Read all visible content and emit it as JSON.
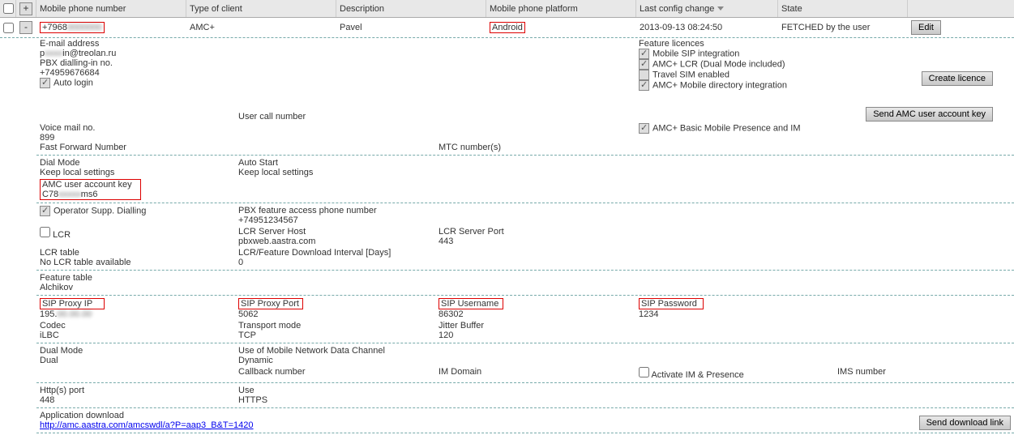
{
  "headers": {
    "phone": "Mobile phone number",
    "client": "Type of client",
    "desc": "Description",
    "platform": "Mobile phone platform",
    "lastcfg": "Last config change",
    "state": "State"
  },
  "row": {
    "phone_pre": "+7968",
    "phone_blur": "0000000",
    "client": "AMC+",
    "desc": "Pavel",
    "platform": "Android",
    "lastcfg": "2013-09-13 08:24:50",
    "state": "FETCHED by the user",
    "edit": "Edit"
  },
  "d": {
    "email_lbl": "E-mail address",
    "email_pre": "p",
    "email_suf": "in@treolan.ru",
    "pbx_lbl": "PBX dialling-in no.",
    "pbx": "+74959676684",
    "autologin": "Auto login",
    "usercall": "User call number",
    "voicemail_lbl": "Voice mail no.",
    "voicemail": "899",
    "ffn": "Fast Forward Number",
    "mtc": "MTC number(s)",
    "dial_lbl": "Dial Mode",
    "dial": "Keep local settings",
    "autostart_lbl": "Auto Start",
    "autostart": "Keep local settings",
    "key_lbl": "AMC user account key",
    "key_pre": "C78",
    "key_suf": "ms6",
    "opsupp": "Operator Supp. Dialling",
    "pbxfeat_lbl": "PBX feature access phone number",
    "pbxfeat": "+74951234567",
    "lcr": "LCR",
    "lcrhost_lbl": "LCR Server Host",
    "lcrhost": "pbxweb.aastra.com",
    "lcrport_lbl": "LCR Server Port",
    "lcrport": "443",
    "lcrtab_lbl": "LCR table",
    "lcrtab": "No LCR table available",
    "lcrint_lbl": "LCR/Feature Download Interval [Days]",
    "lcrint": "0",
    "feat_lbl": "Feature table",
    "feat": "Alchikov",
    "sipip_lbl": "SIP Proxy IP",
    "sipip_pre": "195.",
    "sipport_lbl": "SIP Proxy Port",
    "sipport": "5062",
    "sipuser_lbl": "SIP Username",
    "sipuser": "86302",
    "sippass_lbl": "SIP Password",
    "sippass": "1234",
    "codec_lbl": "Codec",
    "codec": "iLBC",
    "trans_lbl": "Transport mode",
    "trans": "TCP",
    "jitter_lbl": "Jitter Buffer",
    "jitter": "120",
    "dual_lbl": "Dual Mode",
    "dual": "Dual",
    "datach_lbl": "Use of Mobile Network Data Channel",
    "datach": "Dynamic",
    "callback": "Callback number",
    "imdomain": "IM Domain",
    "activateim": "Activate IM & Presence",
    "ims": "IMS number",
    "http_lbl": "Http(s) port",
    "http": "448",
    "use_lbl": "Use",
    "use": "HTTPS",
    "appdl": "Application download",
    "appurl": "http://amc.aastra.com/amcswdl/a?P=aap3_B&T=1420",
    "senddl": "Send download link"
  },
  "lic": {
    "title": "Feature licences",
    "sip": "Mobile SIP integration",
    "lcr": "AMC+ LCR (Dual Mode included)",
    "travel": "Travel SIM enabled",
    "dir": "AMC+ Mobile directory integration",
    "presence": "AMC+ Basic Mobile Presence and IM"
  },
  "btns": {
    "create": "Create licence",
    "sendkey": "Send AMC user account key"
  }
}
